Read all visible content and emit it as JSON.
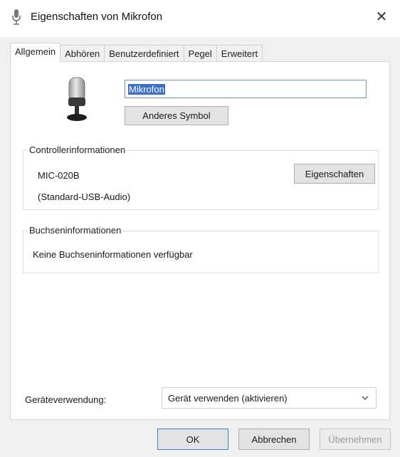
{
  "window": {
    "title": "Eigenschaften von Mikrofon",
    "close_glyph": "✕"
  },
  "tabs": [
    {
      "label": "Allgemein",
      "active": true
    },
    {
      "label": "Abhören",
      "active": false
    },
    {
      "label": "Benutzerdefiniert",
      "active": false
    },
    {
      "label": "Pegel",
      "active": false
    },
    {
      "label": "Erweitert",
      "active": false
    }
  ],
  "device": {
    "icon": "microphone-icon",
    "name_value": "Mikrofon",
    "change_icon_label": "Anderes Symbol"
  },
  "controller": {
    "heading": "Controllerinformationen",
    "model": "MIC-020B",
    "driver": "(Standard-USB-Audio)",
    "properties_label": "Eigenschaften"
  },
  "jack": {
    "heading": "Buchseninformationen",
    "message": "Keine Buchseninformationen verfügbar"
  },
  "usage": {
    "label": "Geräteverwendung:",
    "selected": "Gerät verwenden (aktivieren)"
  },
  "buttons": {
    "ok": "OK",
    "cancel": "Abbrechen",
    "apply": "Übernehmen"
  },
  "colors": {
    "accent": "#3b6fc9",
    "button_face": "#e3e3e3",
    "dialog_bg": "#f0f0f0"
  }
}
